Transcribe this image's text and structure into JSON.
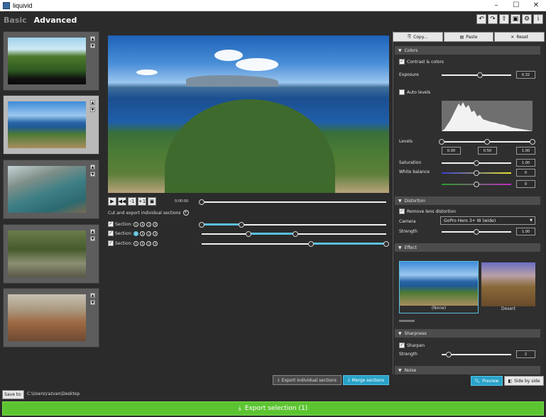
{
  "window": {
    "title": "liquivid",
    "minimize": "–",
    "maximize": "☐",
    "close": "✕"
  },
  "modes": [
    "Basic",
    "Advanced"
  ],
  "toolbar_icons": [
    "undo-icon",
    "redo-icon",
    "export-frame-icon",
    "export-video-icon",
    "settings-icon",
    "info-icon"
  ],
  "toolbar_glyphs": [
    "↶",
    "↷",
    "⇧",
    "▣",
    "⚙",
    "i"
  ],
  "thumb_mini": [
    "▲",
    "▼"
  ],
  "transport": {
    "buttons": [
      "▶",
      "◀◀",
      "-1",
      "+1",
      "▣"
    ],
    "timecode": "0:00:00"
  },
  "cut": {
    "label": "Cut and export individual sections",
    "plus": "+"
  },
  "sections": [
    {
      "label": "Section:",
      "checked": "✓",
      "icons": [
        "L",
        "E",
        "3",
        "X"
      ],
      "highlight": -1
    },
    {
      "label": "Section:",
      "checked": "✓",
      "icons": [
        "L",
        "E",
        "3",
        "X"
      ],
      "highlight": 0
    },
    {
      "label": "Section:",
      "checked": "✓",
      "icons": [
        "L",
        "E",
        "3",
        "X"
      ],
      "highlight": -1
    }
  ],
  "center_buttons": {
    "export_individual": "Export individual sections",
    "merge": "Merge sections"
  },
  "save": {
    "button": "Save to:",
    "path": "C:\\Users\\razvan\\Desktop"
  },
  "export": {
    "label": "Export selection (1)"
  },
  "panel_top": {
    "copy": "Copy...",
    "paste": "Paste",
    "reset": "Reset"
  },
  "colors": {
    "header": "Colors",
    "contrast_label": "Contrast & colors",
    "contrast_checked": "✓",
    "exposure_label": "Exposure",
    "exposure_value": "0.32",
    "auto_levels_label": "Auto levels",
    "levels_label": "Levels",
    "levels_values": [
      "0.00",
      "0.50",
      "1.00"
    ],
    "saturation_label": "Saturation",
    "saturation_value": "1.00",
    "white_balance_label": "White balance",
    "wb_values": [
      "0",
      "0"
    ]
  },
  "distortion": {
    "header": "Distortion",
    "remove_label": "Remove lens distortion",
    "remove_checked": "✓",
    "camera_label": "Camera",
    "camera_value": "GoPro Hero 3+ W (wide)",
    "strength_label": "Strength",
    "strength_value": "1.00"
  },
  "effect": {
    "header": "Effect",
    "items": [
      "(None)",
      "Desert"
    ]
  },
  "sharpness": {
    "header": "Sharpness",
    "sharpen_label": "Sharpen",
    "sharpen_checked": "✓",
    "strength_label": "Strength",
    "strength_value": "2"
  },
  "noise": {
    "header": "Noise"
  },
  "bottom_right": {
    "preview": "Preview",
    "side_by_side": "Side by side"
  }
}
